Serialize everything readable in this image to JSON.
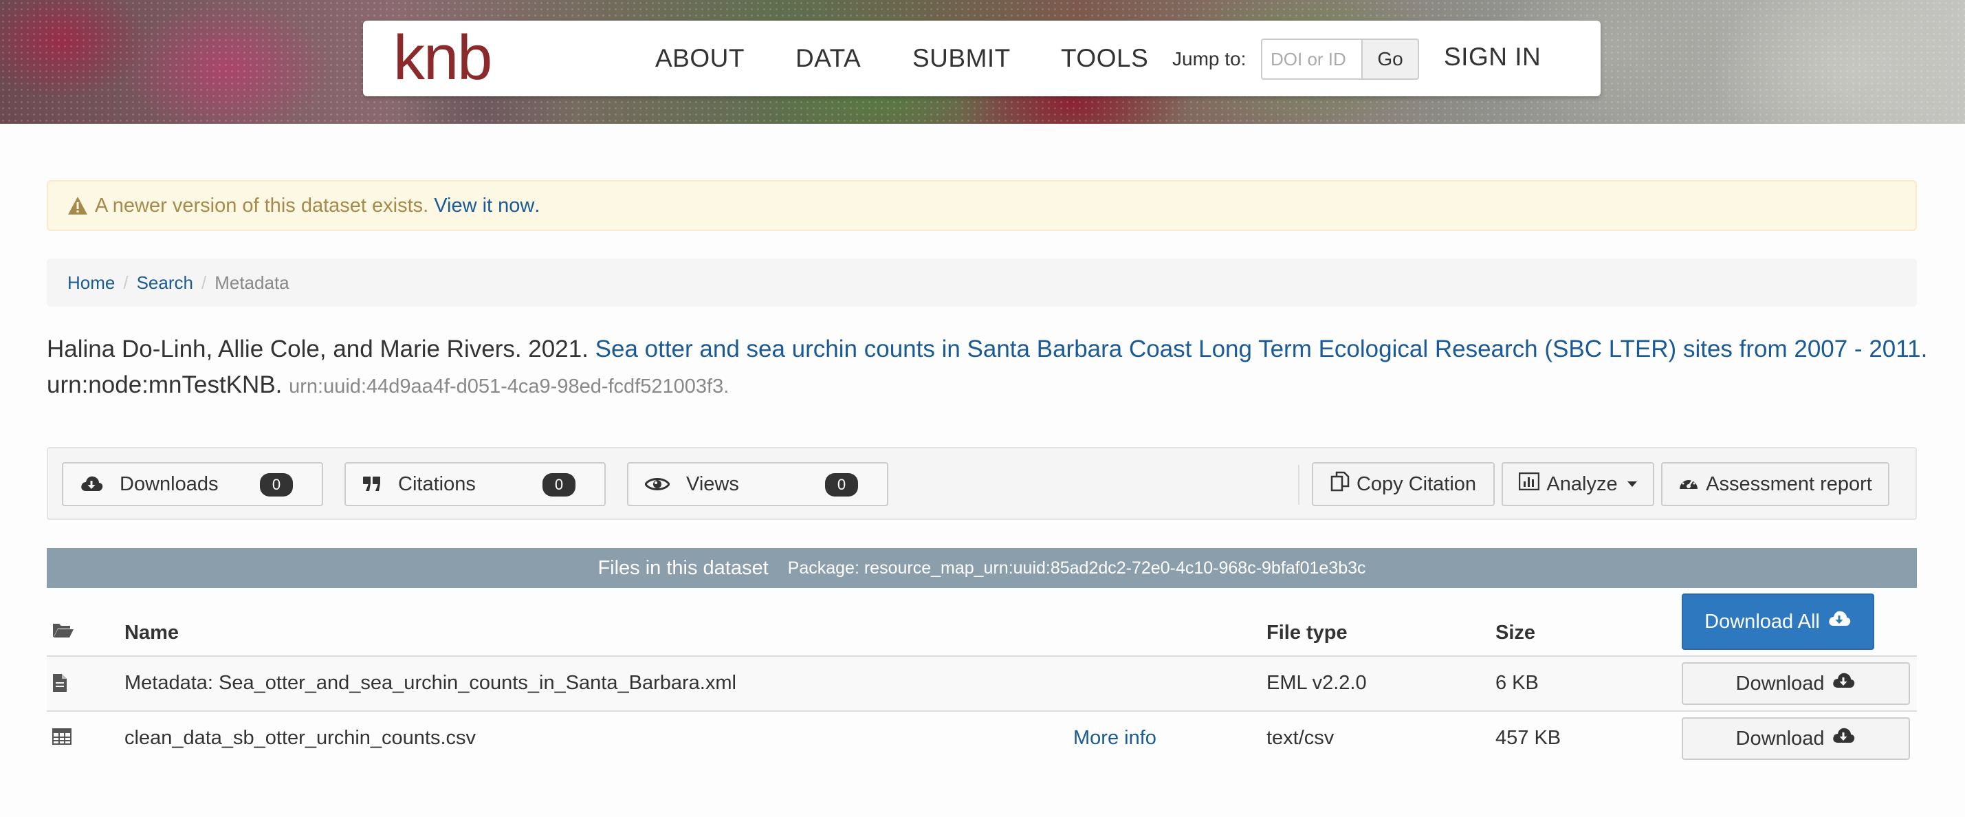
{
  "nav": {
    "logo": "knb",
    "links": [
      "ABOUT",
      "DATA",
      "SUBMIT",
      "TOOLS"
    ],
    "jump_label": "Jump to:",
    "jump_placeholder": "DOI or ID",
    "go_label": "Go",
    "sign_in": "SIGN IN"
  },
  "alert": {
    "text": "A newer version of this dataset exists.",
    "link": "View it now",
    "suffix": "."
  },
  "breadcrumb": {
    "items": [
      "Home",
      "Search"
    ],
    "active": "Metadata",
    "separator": "/"
  },
  "citation": {
    "authors": "Halina Do-Linh, Allie Cole, and Marie Rivers. 2021.",
    "title": "Sea otter and sea urchin counts in Santa Barbara Coast Long Term Ecological Research (SBC LTER) sites from 2007 - 2011.",
    "node": "urn:node:mnTestKNB.",
    "urn": "urn:uuid:44d9aa4f-d051-4ca9-98ed-fcdf521003f3."
  },
  "metrics": [
    {
      "label": "Downloads",
      "count": "0",
      "icon": "cloud-download-icon"
    },
    {
      "label": "Citations",
      "count": "0",
      "icon": "quote-icon"
    },
    {
      "label": "Views",
      "count": "0",
      "icon": "eye-icon"
    }
  ],
  "tools": {
    "copy_citation": "Copy Citation",
    "analyze": "Analyze",
    "assessment": "Assessment report"
  },
  "files": {
    "header_title": "Files in this dataset",
    "package": "Package: resource_map_urn:uuid:85ad2dc2-72e0-4c10-968c-9bfaf01e3b3c",
    "columns": {
      "name": "Name",
      "file_type": "File type",
      "size": "Size"
    },
    "download_all": "Download All",
    "rows": [
      {
        "name": "Metadata: Sea_otter_and_sea_urchin_counts_in_Santa_Barbara.xml",
        "more_info": "",
        "type": "EML v2.2.0",
        "size": "6 KB",
        "action": "Download",
        "icon": "file-icon"
      },
      {
        "name": "clean_data_sb_otter_urchin_counts.csv",
        "more_info": "More info",
        "type": "text/csv",
        "size": "457 KB",
        "action": "Download",
        "icon": "table-icon"
      }
    ]
  },
  "colors": {
    "link": "#1a5a96",
    "logo": "#8b2a2a",
    "primary_button": "#2e78bf",
    "files_header": "#8a9eab",
    "alert_bg": "#fcf8e3"
  }
}
